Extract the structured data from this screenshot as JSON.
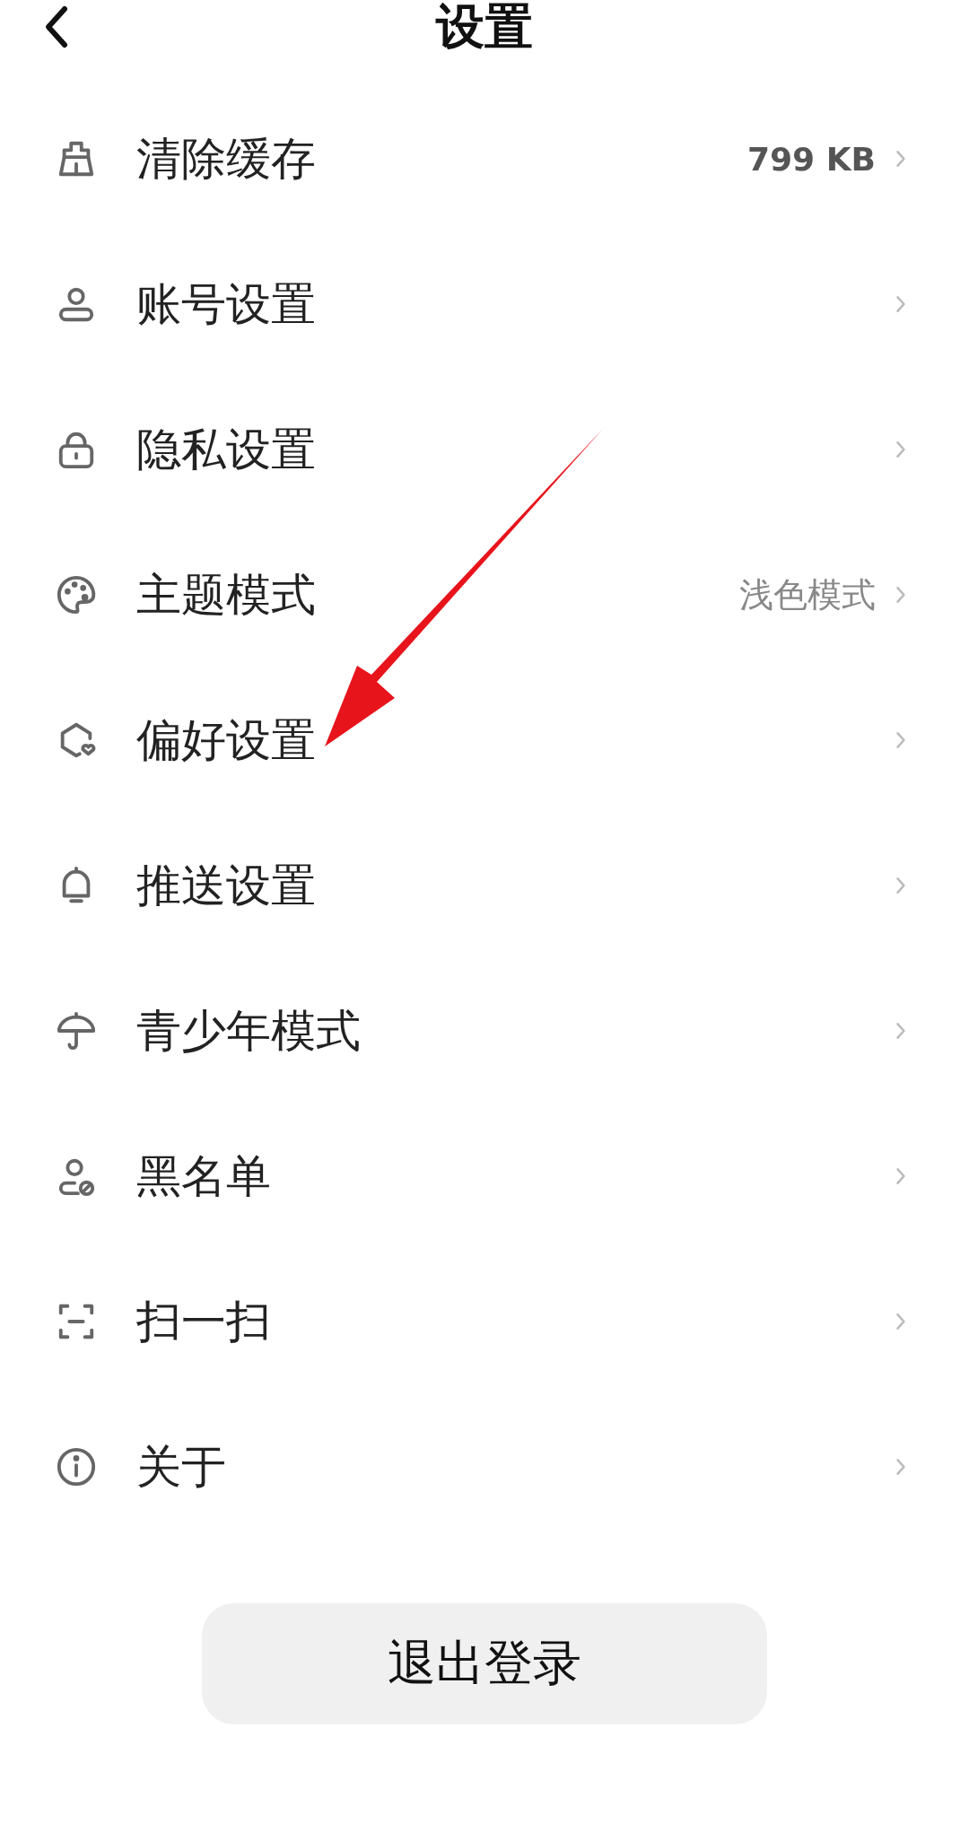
{
  "header": {
    "title": "设置"
  },
  "items": [
    {
      "label": "清除缓存",
      "value": {
        "text": "799 KB",
        "bold": true
      }
    },
    {
      "label": "账号设置"
    },
    {
      "label": "隐私设置"
    },
    {
      "label": "主题模式",
      "value": {
        "text": "浅色模式",
        "bold": false
      }
    },
    {
      "label": "偏好设置"
    },
    {
      "label": "推送设置"
    },
    {
      "label": "青少年模式"
    },
    {
      "label": "黑名单"
    },
    {
      "label": "扫一扫"
    },
    {
      "label": "关于"
    }
  ],
  "logout_button": "退出登录"
}
